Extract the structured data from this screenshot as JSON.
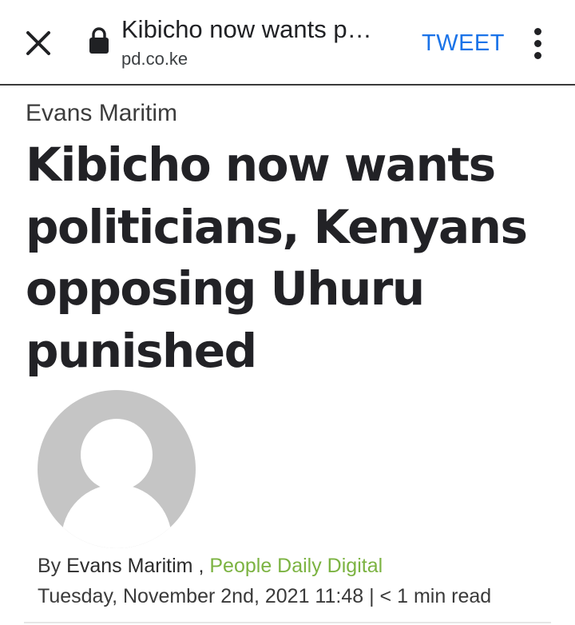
{
  "toolbar": {
    "title": "Kibicho now wants p…",
    "url": "pd.co.ke",
    "action_label": "TWEET",
    "accent_color": "#1a73e8"
  },
  "article": {
    "author_top": "Evans Maritim",
    "headline": "Kibicho now wants politicians, Kenyans opposing Uhuru punished",
    "byline": {
      "prefix": "By",
      "author": "Evans Maritim",
      "separator": ",",
      "source": "People Daily Digital",
      "source_color": "#7cb342"
    },
    "meta": {
      "date": "Tuesday, November 2nd, 2021 11:48",
      "divider": "|",
      "read_time": "< 1 min read"
    }
  },
  "icons": {
    "close": "close-icon",
    "lock": "lock-icon",
    "more": "more-vert-icon",
    "avatar": "default-avatar-icon"
  }
}
